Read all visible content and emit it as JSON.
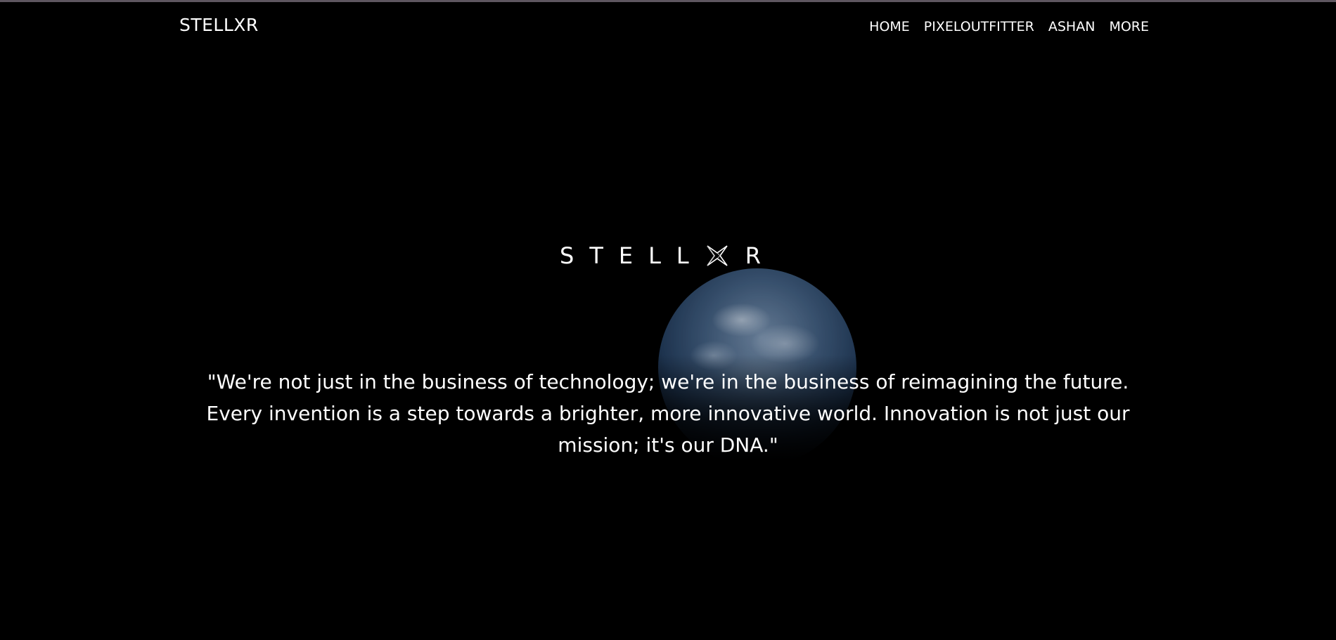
{
  "header": {
    "brand": "STELLXR",
    "nav": {
      "home": "HOME",
      "pixeloutfitter": "PIXELOUTFITTER",
      "ashan": "ASHAN",
      "more": "MORE"
    }
  },
  "hero": {
    "logo_text_left": "STELL",
    "logo_text_right": "R",
    "logo_mark_icon": "star-x-logo-icon",
    "background_image": "earth-from-space",
    "quote_line1": "\"We're not just in the business of technology; we're in the business of reimagining the future.",
    "quote_line2": "Every invention is a step towards a brighter, more innovative world. Innovation is not just our",
    "quote_line3": "mission; it's our DNA.\""
  },
  "colors": {
    "background": "#000000",
    "text": "#ffffff",
    "top_rule": "#5e5660"
  }
}
